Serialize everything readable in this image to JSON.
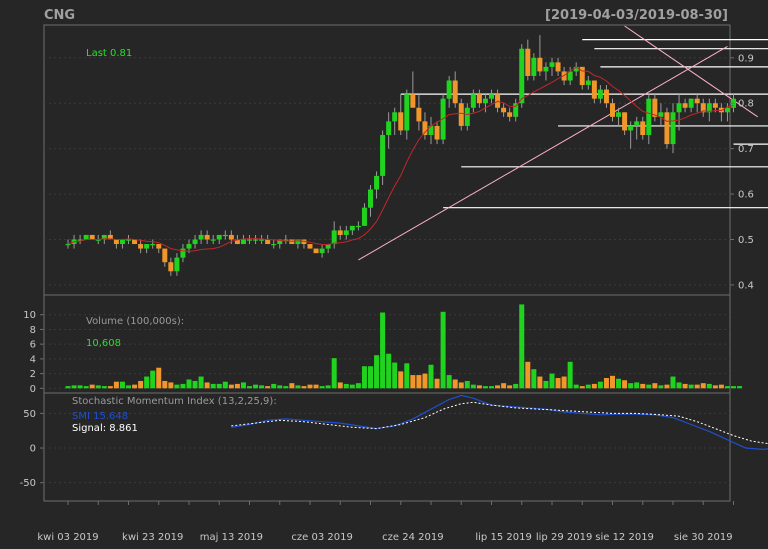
{
  "header": {
    "symbol": "CNG",
    "date_range": "[2019-04-03/2019-08-30]"
  },
  "colors": {
    "background": "#262626",
    "panel": "#222222",
    "frame": "#6e6e6e",
    "grid": "#3a3a3a",
    "up": "#1fd31f",
    "down": "#f0962a",
    "ma": "#c0282a",
    "smi": "#1f4fd0",
    "signal": "#ffffff",
    "label_green": "#27e027",
    "label_gray": "#9a9a9a",
    "trend": "#ffb0d0"
  },
  "chart_data": [
    {
      "type": "candlestick",
      "name": "price",
      "last_label": "Last 0.81",
      "ylim": [
        0.38,
        0.97
      ],
      "y_ticks": [
        "0.4",
        "0.5",
        "0.6",
        "0.7",
        "0.8",
        "0.9"
      ],
      "x_labels": [
        "kwi 03 2019",
        "kwi 23 2019",
        "maj 13 2019",
        "cze 03 2019",
        "cze 24 2019",
        "lip 15 2019",
        "lip 29 2019",
        "sie 12 2019",
        "sie 30 2019"
      ],
      "x_label_index": [
        0,
        14,
        27,
        42,
        57,
        72,
        82,
        92,
        105
      ],
      "candles": [
        [
          0.49,
          0.5,
          0.48,
          0.49
        ],
        [
          0.49,
          0.51,
          0.48,
          0.5
        ],
        [
          0.5,
          0.51,
          0.49,
          0.5
        ],
        [
          0.5,
          0.51,
          0.5,
          0.51
        ],
        [
          0.51,
          0.51,
          0.5,
          0.5
        ],
        [
          0.5,
          0.51,
          0.49,
          0.5
        ],
        [
          0.5,
          0.51,
          0.49,
          0.51
        ],
        [
          0.51,
          0.52,
          0.5,
          0.5
        ],
        [
          0.5,
          0.5,
          0.48,
          0.49
        ],
        [
          0.49,
          0.5,
          0.48,
          0.5
        ],
        [
          0.5,
          0.51,
          0.49,
          0.5
        ],
        [
          0.5,
          0.5,
          0.49,
          0.49
        ],
        [
          0.49,
          0.5,
          0.47,
          0.48
        ],
        [
          0.48,
          0.49,
          0.47,
          0.49
        ],
        [
          0.49,
          0.5,
          0.48,
          0.49
        ],
        [
          0.49,
          0.49,
          0.47,
          0.48
        ],
        [
          0.48,
          0.48,
          0.44,
          0.45
        ],
        [
          0.45,
          0.46,
          0.42,
          0.43
        ],
        [
          0.43,
          0.47,
          0.42,
          0.46
        ],
        [
          0.46,
          0.49,
          0.45,
          0.48
        ],
        [
          0.48,
          0.5,
          0.47,
          0.49
        ],
        [
          0.49,
          0.51,
          0.48,
          0.5
        ],
        [
          0.5,
          0.52,
          0.49,
          0.51
        ],
        [
          0.51,
          0.52,
          0.49,
          0.5
        ],
        [
          0.5,
          0.51,
          0.49,
          0.5
        ],
        [
          0.5,
          0.51,
          0.49,
          0.51
        ],
        [
          0.51,
          0.52,
          0.5,
          0.51
        ],
        [
          0.51,
          0.52,
          0.49,
          0.5
        ],
        [
          0.5,
          0.51,
          0.49,
          0.49
        ],
        [
          0.49,
          0.51,
          0.49,
          0.5
        ],
        [
          0.5,
          0.51,
          0.49,
          0.5
        ],
        [
          0.5,
          0.51,
          0.49,
          0.5
        ],
        [
          0.5,
          0.51,
          0.49,
          0.5
        ],
        [
          0.5,
          0.51,
          0.49,
          0.49
        ],
        [
          0.49,
          0.5,
          0.48,
          0.49
        ],
        [
          0.49,
          0.5,
          0.48,
          0.5
        ],
        [
          0.5,
          0.51,
          0.49,
          0.5
        ],
        [
          0.5,
          0.5,
          0.49,
          0.49
        ],
        [
          0.49,
          0.5,
          0.48,
          0.5
        ],
        [
          0.5,
          0.5,
          0.48,
          0.49
        ],
        [
          0.49,
          0.49,
          0.48,
          0.48
        ],
        [
          0.48,
          0.48,
          0.47,
          0.47
        ],
        [
          0.47,
          0.49,
          0.46,
          0.48
        ],
        [
          0.48,
          0.49,
          0.47,
          0.49
        ],
        [
          0.49,
          0.54,
          0.48,
          0.52
        ],
        [
          0.52,
          0.53,
          0.5,
          0.51
        ],
        [
          0.51,
          0.53,
          0.5,
          0.52
        ],
        [
          0.52,
          0.53,
          0.51,
          0.53
        ],
        [
          0.53,
          0.54,
          0.52,
          0.53
        ],
        [
          0.53,
          0.58,
          0.53,
          0.57
        ],
        [
          0.57,
          0.62,
          0.55,
          0.61
        ],
        [
          0.61,
          0.65,
          0.59,
          0.64
        ],
        [
          0.64,
          0.74,
          0.62,
          0.73
        ],
        [
          0.73,
          0.78,
          0.7,
          0.76
        ],
        [
          0.76,
          0.79,
          0.73,
          0.78
        ],
        [
          0.78,
          0.82,
          0.73,
          0.74
        ],
        [
          0.74,
          0.83,
          0.72,
          0.82
        ],
        [
          0.82,
          0.87,
          0.79,
          0.79
        ],
        [
          0.79,
          0.82,
          0.74,
          0.76
        ],
        [
          0.76,
          0.78,
          0.72,
          0.73
        ],
        [
          0.73,
          0.77,
          0.71,
          0.75
        ],
        [
          0.75,
          0.76,
          0.71,
          0.72
        ],
        [
          0.72,
          0.82,
          0.71,
          0.81
        ],
        [
          0.81,
          0.86,
          0.79,
          0.85
        ],
        [
          0.85,
          0.87,
          0.79,
          0.8
        ],
        [
          0.8,
          0.81,
          0.74,
          0.75
        ],
        [
          0.75,
          0.8,
          0.74,
          0.79
        ],
        [
          0.79,
          0.83,
          0.78,
          0.82
        ],
        [
          0.82,
          0.83,
          0.79,
          0.8
        ],
        [
          0.8,
          0.82,
          0.78,
          0.81
        ],
        [
          0.81,
          0.83,
          0.8,
          0.82
        ],
        [
          0.82,
          0.83,
          0.78,
          0.79
        ],
        [
          0.79,
          0.8,
          0.77,
          0.78
        ],
        [
          0.78,
          0.79,
          0.76,
          0.77
        ],
        [
          0.77,
          0.81,
          0.76,
          0.8
        ],
        [
          0.8,
          0.93,
          0.79,
          0.92
        ],
        [
          0.92,
          0.94,
          0.85,
          0.86
        ],
        [
          0.86,
          0.91,
          0.85,
          0.9
        ],
        [
          0.9,
          0.95,
          0.86,
          0.87
        ],
        [
          0.87,
          0.89,
          0.85,
          0.88
        ],
        [
          0.88,
          0.9,
          0.86,
          0.89
        ],
        [
          0.89,
          0.9,
          0.86,
          0.87
        ],
        [
          0.87,
          0.88,
          0.84,
          0.85
        ],
        [
          0.85,
          0.88,
          0.84,
          0.87
        ],
        [
          0.87,
          0.89,
          0.86,
          0.88
        ],
        [
          0.88,
          0.88,
          0.83,
          0.84
        ],
        [
          0.84,
          0.86,
          0.83,
          0.85
        ],
        [
          0.85,
          0.85,
          0.8,
          0.81
        ],
        [
          0.81,
          0.84,
          0.8,
          0.83
        ],
        [
          0.83,
          0.84,
          0.79,
          0.8
        ],
        [
          0.8,
          0.81,
          0.76,
          0.77
        ],
        [
          0.77,
          0.79,
          0.75,
          0.78
        ],
        [
          0.78,
          0.78,
          0.73,
          0.74
        ],
        [
          0.74,
          0.76,
          0.7,
          0.75
        ],
        [
          0.75,
          0.77,
          0.72,
          0.76
        ],
        [
          0.76,
          0.77,
          0.72,
          0.73
        ],
        [
          0.73,
          0.82,
          0.71,
          0.81
        ],
        [
          0.81,
          0.82,
          0.76,
          0.77
        ],
        [
          0.77,
          0.8,
          0.75,
          0.78
        ],
        [
          0.78,
          0.79,
          0.7,
          0.71
        ],
        [
          0.71,
          0.8,
          0.69,
          0.78
        ],
        [
          0.78,
          0.82,
          0.74,
          0.8
        ],
        [
          0.8,
          0.81,
          0.78,
          0.79
        ],
        [
          0.79,
          0.81,
          0.78,
          0.81
        ],
        [
          0.81,
          0.82,
          0.78,
          0.8
        ],
        [
          0.8,
          0.81,
          0.77,
          0.78
        ],
        [
          0.78,
          0.81,
          0.76,
          0.8
        ],
        [
          0.8,
          0.81,
          0.78,
          0.79
        ],
        [
          0.79,
          0.8,
          0.76,
          0.78
        ],
        [
          0.78,
          0.8,
          0.76,
          0.79
        ],
        [
          0.79,
          0.82,
          0.78,
          0.81
        ]
      ],
      "levels": [
        {
          "y": 0.94,
          "from": 85,
          "to": 132
        },
        {
          "y": 0.92,
          "from": 87,
          "to": 132
        },
        {
          "y": 0.88,
          "from": 88,
          "to": 132
        },
        {
          "y": 0.82,
          "from": 55,
          "to": 132
        },
        {
          "y": 0.75,
          "from": 81,
          "to": 132
        },
        {
          "y": 0.71,
          "from": 110,
          "to": 132
        },
        {
          "y": 0.66,
          "from": 65,
          "to": 132
        },
        {
          "y": 0.57,
          "from": 62,
          "to": 132
        }
      ],
      "trendlines": [
        {
          "from": [
            48,
            0.455
          ],
          "to": [
            109,
            0.925
          ]
        },
        {
          "from": [
            92,
            0.97
          ],
          "to": [
            114,
            0.77
          ]
        }
      ]
    },
    {
      "type": "bar",
      "name": "volume",
      "label": "Volume (100,000s):",
      "last_value": "10,608",
      "ylim": [
        -0.5,
        12
      ],
      "y_ticks": [
        "0",
        "2",
        "4",
        "6",
        "8",
        "10"
      ],
      "values": [
        0.3,
        0.4,
        0.4,
        0.3,
        0.5,
        0.4,
        0.3,
        0.3,
        0.9,
        0.9,
        0.4,
        0.5,
        1.0,
        1.6,
        2.4,
        2.8,
        1.0,
        0.8,
        0.5,
        0.6,
        1.2,
        1.0,
        1.6,
        0.8,
        0.6,
        0.6,
        0.9,
        0.5,
        0.6,
        0.8,
        0.3,
        0.5,
        0.4,
        0.3,
        0.6,
        0.4,
        0.3,
        0.7,
        0.4,
        0.3,
        0.5,
        0.5,
        0.3,
        0.4,
        4.1,
        0.8,
        0.6,
        0.5,
        0.7,
        3.0,
        3.0,
        4.5,
        10.3,
        4.7,
        3.5,
        2.3,
        3.4,
        1.8,
        1.8,
        2.0,
        3.2,
        1.3,
        10.4,
        1.8,
        1.2,
        0.8,
        1.0,
        0.5,
        0.4,
        0.3,
        0.3,
        0.4,
        0.7,
        0.4,
        0.6,
        11.4,
        3.6,
        2.6,
        1.6,
        1.0,
        2.0,
        1.4,
        1.6,
        3.6,
        0.5,
        0.3,
        0.5,
        0.6,
        0.9,
        1.4,
        1.7,
        1.3,
        1.1,
        0.7,
        0.8,
        0.6,
        0.5,
        0.7,
        0.4,
        0.5,
        1.6,
        0.8,
        0.6,
        0.5,
        0.5,
        0.7,
        0.6,
        0.4,
        0.5,
        0.3,
        0.3,
        0.3
      ]
    },
    {
      "type": "line",
      "name": "smi",
      "label": "Stochastic Momentum Index (13,2,25,9):",
      "smi_label": "SMI 15.648",
      "signal_label": "Signal: 8.861",
      "ylim": [
        -75,
        78
      ],
      "y_ticks": [
        "50",
        "0",
        "-50"
      ],
      "smi": [
        [
          27,
          30
        ],
        [
          30,
          34
        ],
        [
          33,
          40
        ],
        [
          36,
          42
        ],
        [
          39,
          40
        ],
        [
          42,
          38
        ],
        [
          45,
          36
        ],
        [
          48,
          32
        ],
        [
          51,
          28
        ],
        [
          54,
          32
        ],
        [
          57,
          42
        ],
        [
          60,
          56
        ],
        [
          63,
          70
        ],
        [
          65,
          76
        ],
        [
          67,
          72
        ],
        [
          70,
          62
        ],
        [
          73,
          60
        ],
        [
          76,
          58
        ],
        [
          79,
          56
        ],
        [
          82,
          52
        ],
        [
          85,
          50
        ],
        [
          88,
          48
        ],
        [
          91,
          49
        ],
        [
          94,
          49
        ],
        [
          97,
          48
        ],
        [
          100,
          44
        ],
        [
          103,
          34
        ],
        [
          106,
          24
        ],
        [
          109,
          12
        ],
        [
          112,
          0
        ],
        [
          115,
          -2
        ],
        [
          118,
          2
        ],
        [
          121,
          -4
        ],
        [
          124,
          -2
        ],
        [
          127,
          6
        ],
        [
          130,
          14
        ],
        [
          131,
          15.648
        ]
      ],
      "signal": [
        [
          27,
          32
        ],
        [
          31,
          36
        ],
        [
          35,
          40
        ],
        [
          39,
          38
        ],
        [
          43,
          34
        ],
        [
          47,
          30
        ],
        [
          51,
          28
        ],
        [
          55,
          34
        ],
        [
          59,
          44
        ],
        [
          62,
          56
        ],
        [
          65,
          64
        ],
        [
          67,
          66
        ],
        [
          70,
          62
        ],
        [
          74,
          58
        ],
        [
          78,
          56
        ],
        [
          82,
          54
        ],
        [
          86,
          52
        ],
        [
          90,
          50
        ],
        [
          94,
          50
        ],
        [
          98,
          48
        ],
        [
          101,
          46
        ],
        [
          104,
          38
        ],
        [
          107,
          28
        ],
        [
          110,
          18
        ],
        [
          113,
          10
        ],
        [
          116,
          6
        ],
        [
          120,
          4
        ],
        [
          124,
          4
        ],
        [
          128,
          6
        ],
        [
          131,
          8.861
        ]
      ]
    }
  ]
}
